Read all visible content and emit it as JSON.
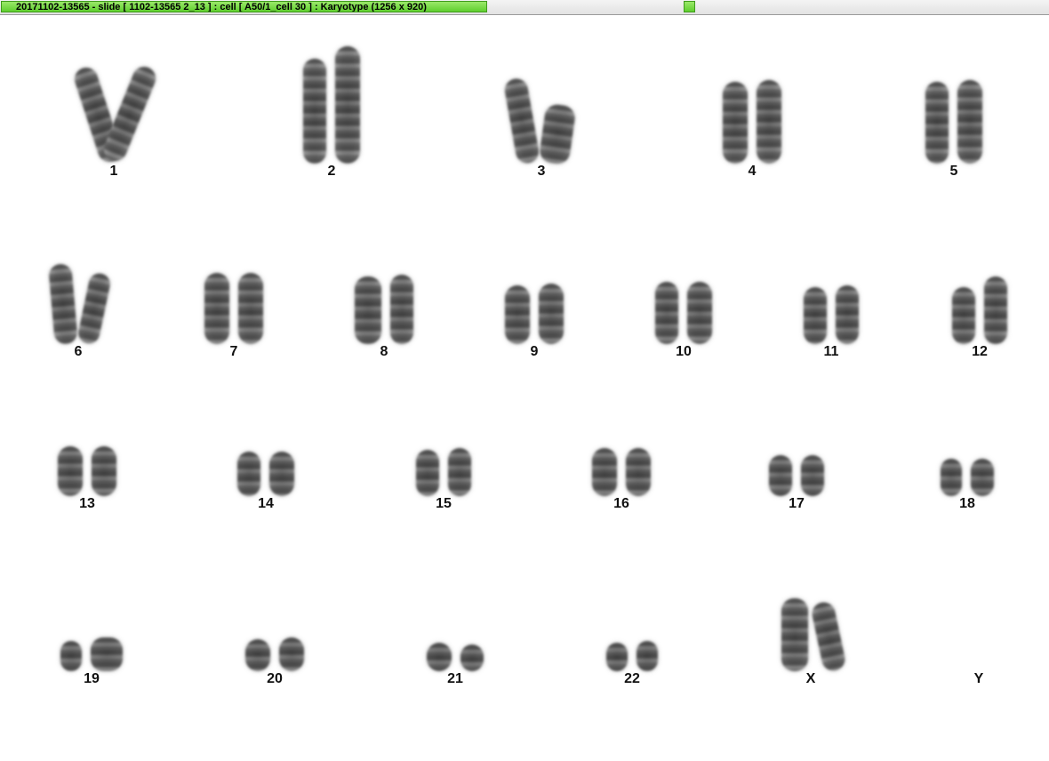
{
  "window": {
    "title": "20171102-13565 - slide [ 1102-13565 2_13 ] : cell [ A50/1_cell 30 ] : Karyotype  (1256 x 920)"
  },
  "karyotype": {
    "labels": [
      "1",
      "2",
      "3",
      "4",
      "5",
      "6",
      "7",
      "8",
      "9",
      "10",
      "11",
      "12",
      "13",
      "14",
      "15",
      "16",
      "17",
      "18",
      "19",
      "20",
      "21",
      "22",
      "X",
      "Y"
    ]
  }
}
